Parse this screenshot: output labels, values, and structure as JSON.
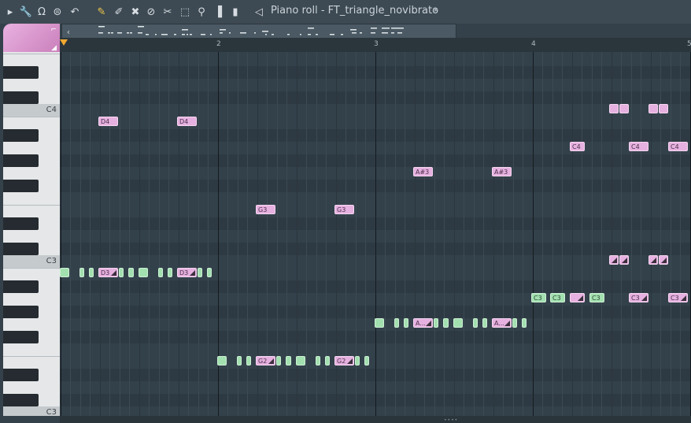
{
  "toolbar": {
    "title": "Piano roll - FT_triangle_novibrato",
    "title_dropdown_icon": "triangle-right",
    "tools": [
      {
        "name": "menu-arrow-icon",
        "glyph": "▸"
      },
      {
        "name": "wrench-icon",
        "glyph": "🔧"
      },
      {
        "name": "magnet-icon",
        "glyph": "Ω"
      },
      {
        "name": "playback-mode-icon",
        "glyph": "⊜"
      },
      {
        "name": "undo-icon",
        "glyph": "↶"
      },
      {
        "name": "pencil-icon",
        "glyph": "✎"
      },
      {
        "name": "paint-brush-icon",
        "glyph": "✐"
      },
      {
        "name": "delete-icon",
        "glyph": "✖"
      },
      {
        "name": "mute-icon",
        "glyph": "⊘"
      },
      {
        "name": "slice-icon",
        "glyph": "✂"
      },
      {
        "name": "select-icon",
        "glyph": "⬚"
      },
      {
        "name": "zoom-icon",
        "glyph": "⚲"
      },
      {
        "name": "playback-icon",
        "glyph": "▐"
      },
      {
        "name": "speaker-icon",
        "glyph": "◁"
      }
    ]
  },
  "ruler": {
    "bars": [
      "2",
      "3",
      "4",
      "5"
    ]
  },
  "keyboard": {
    "labels": {
      "c4": "C4",
      "c3": "C3"
    }
  },
  "notes": [
    {
      "label": "D4",
      "color": "pink"
    },
    {
      "label": "D4",
      "color": "pink"
    },
    {
      "label": "G3",
      "color": "pink"
    },
    {
      "label": "G3",
      "color": "pink"
    },
    {
      "label": "A#3",
      "color": "pink"
    },
    {
      "label": "A#3",
      "color": "pink"
    },
    {
      "label": "C4",
      "color": "pink"
    },
    {
      "label": "C4",
      "color": "pink"
    },
    {
      "label": "C4",
      "color": "pink"
    },
    {
      "label": "D3",
      "color": "pink"
    },
    {
      "label": "D3",
      "color": "pink"
    },
    {
      "label": "G2",
      "color": "pink"
    },
    {
      "label": "G2",
      "color": "pink"
    },
    {
      "label": "A...",
      "color": "pink"
    },
    {
      "label": "A...",
      "color": "pink"
    },
    {
      "label": "C3",
      "color": "green"
    },
    {
      "label": "C3",
      "color": "green"
    },
    {
      "label": "C3",
      "color": "green"
    },
    {
      "label": "C3",
      "color": "pink"
    },
    {
      "label": "C3",
      "color": "pink"
    }
  ]
}
